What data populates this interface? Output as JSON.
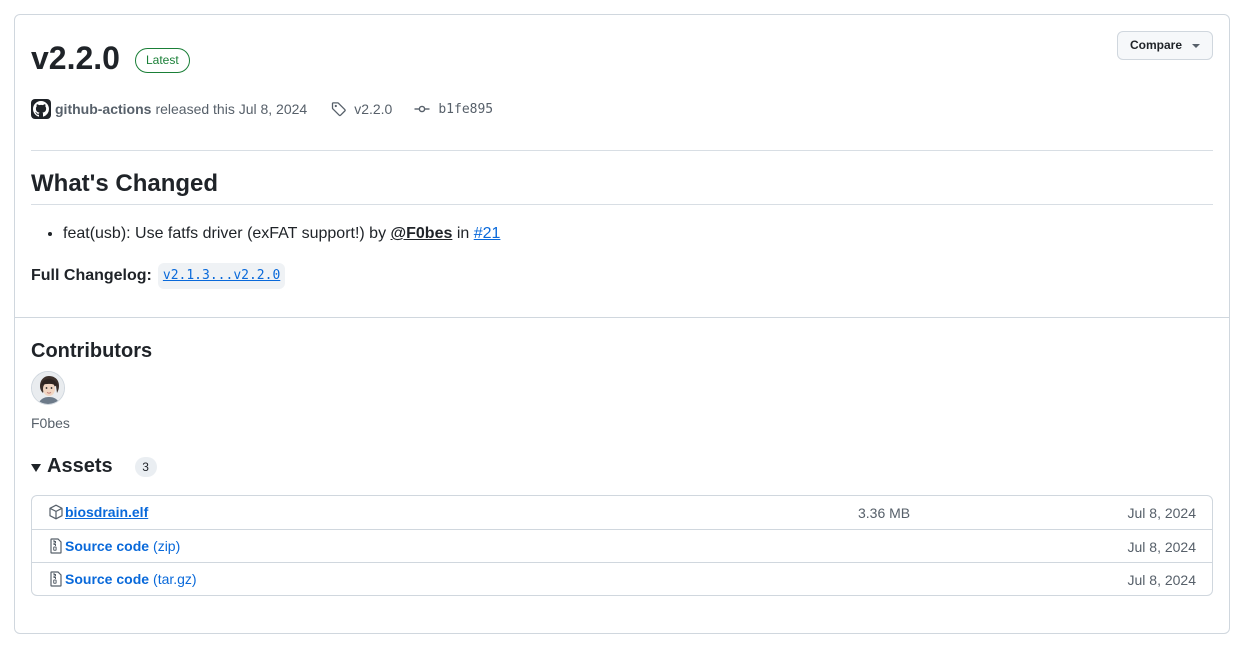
{
  "release": {
    "version": "v2.2.0",
    "badge": "Latest",
    "compare_label": "Compare",
    "actor": "github-actions",
    "released_text": "released this Jul 8, 2024",
    "tag": "v2.2.0",
    "commit": "b1fe895"
  },
  "notes": {
    "heading": "What's Changed",
    "items": [
      {
        "prefix": "feat(usb): Use fatfs driver (exFAT support!) by ",
        "user": "@F0bes",
        "mid": " in ",
        "issue": "#21"
      }
    ],
    "changelog_label": "Full Changelog:",
    "changelog_link": "v2.1.3...v2.2.0"
  },
  "contributors": {
    "heading": "Contributors",
    "names": [
      "F0bes"
    ]
  },
  "assets": {
    "heading": "Assets",
    "count": "3",
    "items": [
      {
        "name": "biosdrain.elf",
        "sub": "",
        "size": "3.36 MB",
        "date": "Jul 8, 2024",
        "icon": "package-icon"
      },
      {
        "name": "Source code",
        "sub": "(zip)",
        "size": "",
        "date": "Jul 8, 2024",
        "icon": "file-zip-icon"
      },
      {
        "name": "Source code",
        "sub": "(tar.gz)",
        "size": "",
        "date": "Jul 8, 2024",
        "icon": "file-zip-icon"
      }
    ]
  },
  "colors": {
    "accent_link": "#0969da",
    "latest_badge": "#1a7f37",
    "muted_text": "#57606a",
    "border": "#d0d7de"
  }
}
